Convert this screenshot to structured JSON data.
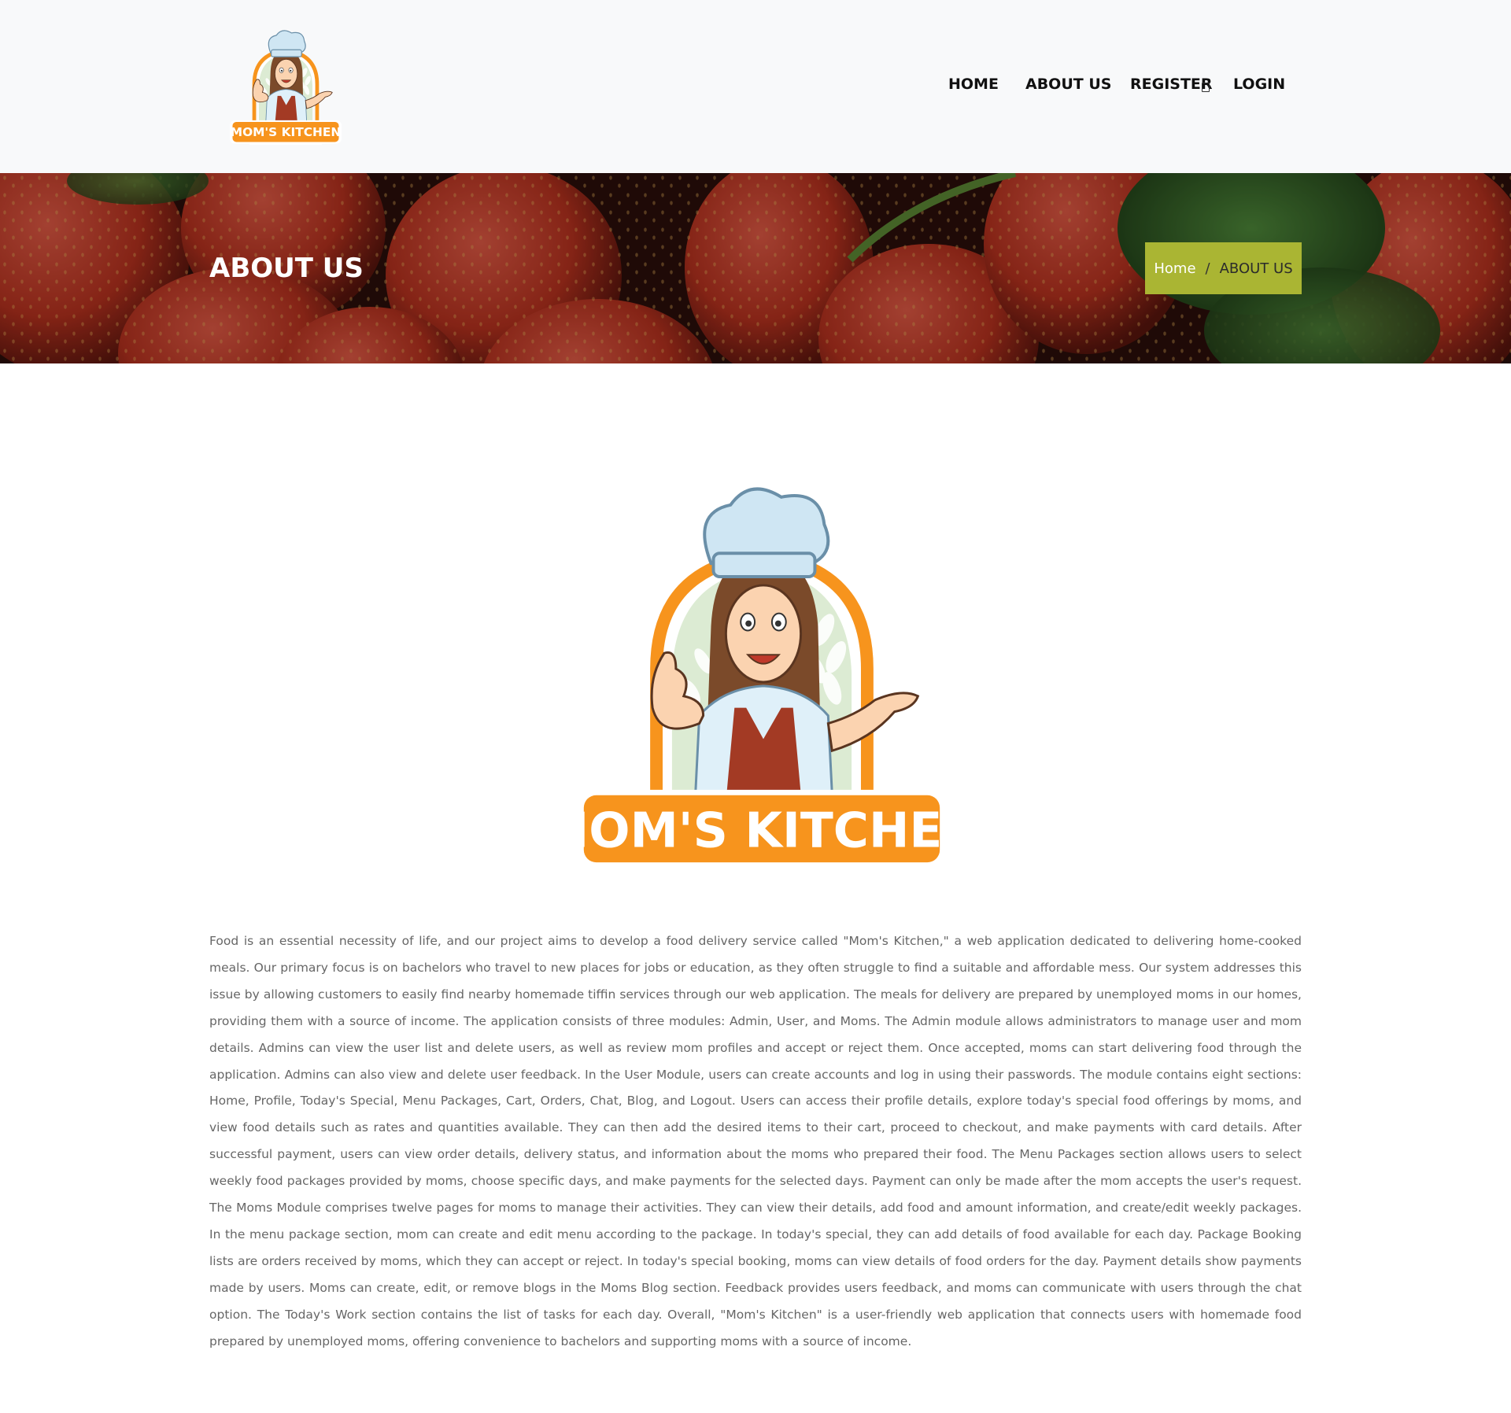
{
  "header": {
    "logo_text": "MOM'S KITCHEN",
    "nav": {
      "home": "HOME",
      "about": "ABOUT US",
      "register": "REGISTER",
      "login": "LOGIN"
    }
  },
  "banner": {
    "title": "ABOUT US",
    "breadcrumb": {
      "home": "Home",
      "separator": "/",
      "current": "ABOUT US"
    }
  },
  "main": {
    "logo_text": "MOM'S KITCHEN",
    "paragraph": "Food is an essential necessity of life, and our project aims to develop a food delivery service called \"Mom's Kitchen,\" a web application dedicated to delivering home-cooked meals. Our primary focus is on bachelors who travel to new places for jobs or education, as they often struggle to find a suitable and affordable mess. Our system addresses this issue by allowing customers to easily find nearby homemade tiffin services through our web application. The meals for delivery are prepared by unemployed moms in our homes, providing them with a source of income. The application consists of three modules: Admin, User, and Moms. The Admin module allows administrators to manage user and mom details. Admins can view the user list and delete users, as well as review mom profiles and accept or reject them. Once accepted, moms can start delivering food through the application. Admins can also view and delete user feedback. In the User Module, users can create accounts and log in using their passwords. The module contains eight sections: Home, Profile, Today's Special, Menu Packages, Cart, Orders, Chat, Blog, and Logout. Users can access their profile details, explore today's special food offerings by moms, and view food details such as rates and quantities available. They can then add the desired items to their cart, proceed to checkout, and make payments with card details. After successful payment, users can view order details, delivery status, and information about the moms who prepared their food. The Menu Packages section allows users to select weekly food packages provided by moms, choose specific days, and make payments for the selected days. Payment can only be made after the mom accepts the user's request. The Moms Module comprises twelve pages for moms to manage their activities. They can view their details, add food and amount information, and create/edit weekly packages. In the menu package section, mom can create and edit menu according to the package. In today's special, they can add details of food available for each day. Package Booking lists are orders received by moms, which they can accept or reject. In today's special booking, moms can view details of food orders for the day. Payment details show payments made by users. Moms can create, edit, or remove blogs in the Moms Blog section. Feedback provides users feedback, and moms can communicate with users through the chat option. The Today's Work section contains the list of tasks for each day. Overall, \"Mom's Kitchen\" is a user-friendly web application that connects users with homemade food prepared by unemployed moms, offering convenience to bachelors and supporting moms with a source of income."
  },
  "colors": {
    "header_bg": "#f8f9fa",
    "breadcrumb_bg": "#aab533",
    "logo_orange": "#f7941d",
    "text_gray": "#666666"
  }
}
